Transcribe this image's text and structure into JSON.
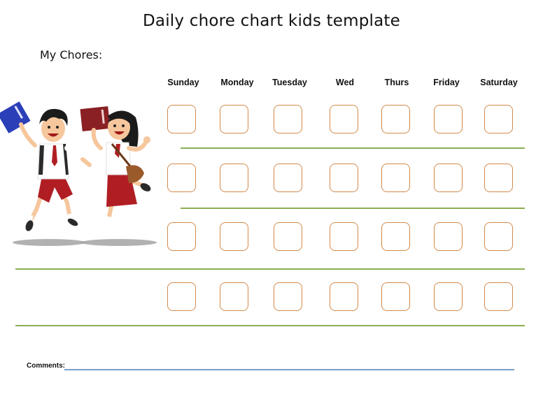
{
  "title": "Daily chore chart kids template",
  "subtitle": "My Chores:",
  "days": [
    "Sunday",
    "Monday",
    "Tuesday",
    "Wed",
    "Thurs",
    "Friday",
    "Saturday"
  ],
  "chores": [
    {
      "checked": [
        false,
        false,
        false,
        false,
        false,
        false,
        false
      ]
    },
    {
      "checked": [
        false,
        false,
        false,
        false,
        false,
        false,
        false
      ]
    },
    {
      "checked": [
        false,
        false,
        false,
        false,
        false,
        false,
        false
      ]
    },
    {
      "checked": [
        false,
        false,
        false,
        false,
        false,
        false,
        false
      ]
    }
  ],
  "comments": {
    "label": "Comments:",
    "value": ""
  },
  "illustration": {
    "subject": "two-kids-jumping-with-books"
  },
  "colors": {
    "checkbox_border": "#d28a4c",
    "row_line": "#8cae55",
    "comments_line": "#7a9ec8"
  }
}
